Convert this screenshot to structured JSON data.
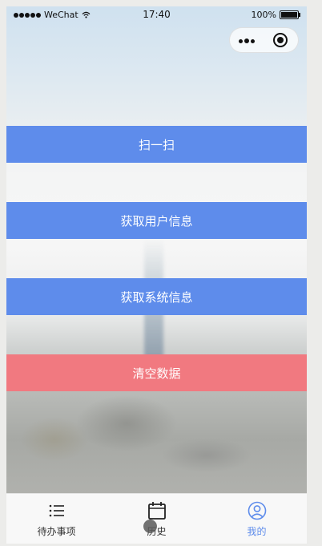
{
  "status_bar": {
    "carrier": "WeChat",
    "time": "17:40",
    "battery": "100%"
  },
  "capsule": {
    "more_icon": "more-dots-icon",
    "close_icon": "target-close-icon"
  },
  "buttons": {
    "scan": "扫一扫",
    "user_info": "获取用户信息",
    "system_info": "获取系统信息",
    "clear": "清空数据"
  },
  "tabbar": {
    "items": [
      {
        "label": "待办事项",
        "icon": "list-icon",
        "active": false
      },
      {
        "label": "历史",
        "icon": "calendar-icon",
        "active": false
      },
      {
        "label": "我的",
        "icon": "user-icon",
        "active": true
      }
    ]
  },
  "colors": {
    "primary_button": "#5e8ceb",
    "danger_button": "#f17980",
    "active_tab": "#5e8ceb"
  }
}
